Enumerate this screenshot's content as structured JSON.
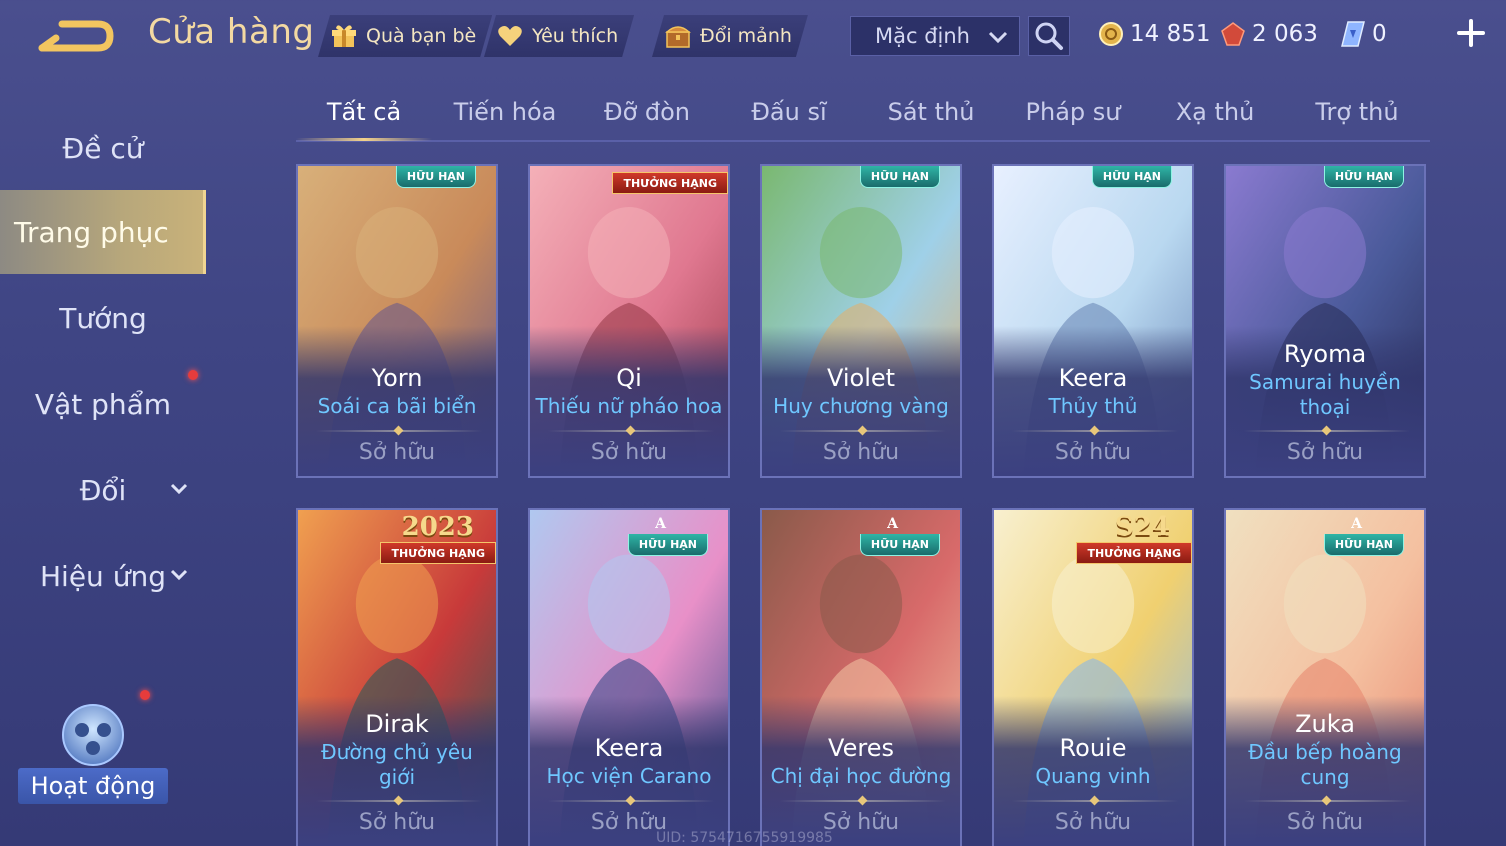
{
  "header": {
    "title": "Cửa hàng",
    "buttons": [
      {
        "label": "Quà bạn bè",
        "icon": "gift-icon"
      },
      {
        "label": "Yêu thích",
        "icon": "heart-icon"
      },
      {
        "label": "Đổi mảnh",
        "icon": "chest-icon"
      }
    ],
    "sort": {
      "selected": "Mặc định"
    },
    "currencies": [
      {
        "icon": "gold-coin-icon",
        "value": "14 851"
      },
      {
        "icon": "voucher-gem-icon",
        "value": "2 063"
      },
      {
        "icon": "quan-huy-icon",
        "value": "0"
      }
    ]
  },
  "sidebar": {
    "items": [
      {
        "label": "Đề cử"
      },
      {
        "label": "Trang phục"
      },
      {
        "label": "Tướng"
      },
      {
        "label": "Vật phẩm"
      },
      {
        "label": "Đổi"
      },
      {
        "label": "Hiệu ứng"
      }
    ],
    "activity_label": "Hoạt động"
  },
  "tabs": [
    "Tất cả",
    "Tiến hóa",
    "Đỡ đòn",
    "Đấu sĩ",
    "Sát thủ",
    "Pháp sư",
    "Xạ thủ",
    "Trợ thủ"
  ],
  "cards": [
    {
      "hero": "Yorn",
      "skin": "Soái ca bãi biển",
      "status": "Sở hữu",
      "badge": "HỮU HẠN",
      "badge_type": "limited"
    },
    {
      "hero": "Qi",
      "skin": "Thiếu nữ pháo hoa",
      "status": "Sở hữu",
      "badge": "THƯỞNG HẠNG",
      "badge_type": "rank"
    },
    {
      "hero": "Violet",
      "skin": "Huy chương vàng",
      "status": "Sở hữu",
      "badge": "HỮU HẠN",
      "badge_type": "limited"
    },
    {
      "hero": "Keera",
      "skin": "Thủy thủ",
      "status": "Sở hữu",
      "badge": "HỮU HẠN",
      "badge_type": "limited"
    },
    {
      "hero": "Ryoma",
      "skin": "Samurai huyền thoại",
      "status": "Sở hữu",
      "badge": "HỮU HẠN",
      "badge_type": "limited"
    },
    {
      "hero": "Dirak",
      "skin": "Đường chủ yêu giới",
      "status": "Sở hữu",
      "badge": "THƯỞNG HẠNG",
      "badge_type": "rank",
      "badge_top": "2023"
    },
    {
      "hero": "Keera",
      "skin": "Học viện Carano",
      "status": "Sở hữu",
      "badge": "HỮU HẠN",
      "badge_type": "limited",
      "tier": "A"
    },
    {
      "hero": "Veres",
      "skin": "Chị đại học đường",
      "status": "Sở hữu",
      "badge": "HỮU HẠN",
      "badge_type": "limited",
      "tier": "A"
    },
    {
      "hero": "Rouie",
      "skin": "Quang vinh",
      "status": "Sở hữu",
      "badge": "THƯỞNG HẠNG",
      "badge_type": "rank",
      "badge_top": "S24"
    },
    {
      "hero": "Zuka",
      "skin": "Đầu bếp hoàng cung",
      "status": "Sở hữu",
      "badge": "HỮU HẠN",
      "badge_type": "limited",
      "tier": "A"
    }
  ],
  "uid": "UID: 5754716755919985",
  "colors": {
    "accent_gold": "#f3d9a2",
    "skin_name": "#6fc7ff",
    "rank_badge": "#d0392a",
    "limited_badge": "#2fb5a6"
  }
}
